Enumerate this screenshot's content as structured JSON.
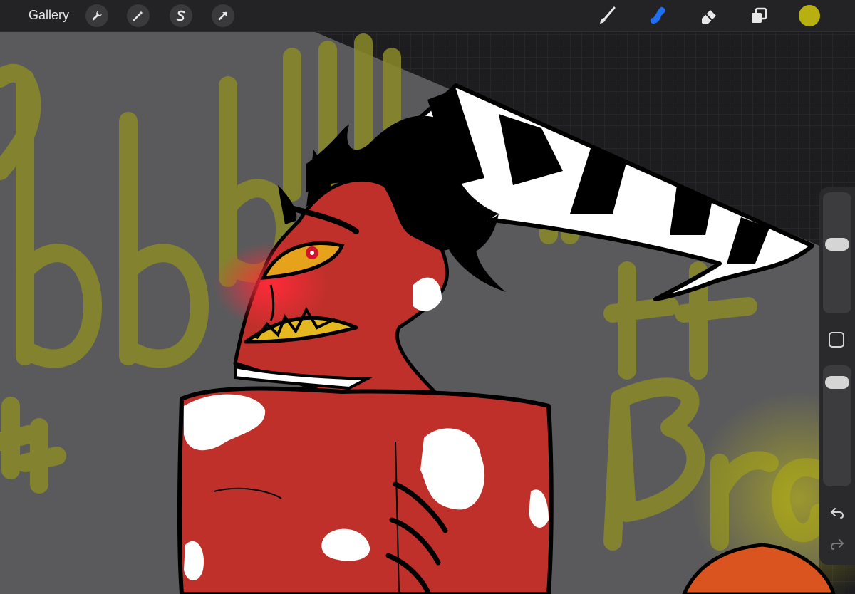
{
  "topbar": {
    "gallery_label": "Gallery",
    "left_tools": [
      "wrench-icon",
      "magic-wand-icon",
      "selection-s-icon",
      "transform-arrow-icon"
    ],
    "right_tools": [
      "brush-icon",
      "smudge-icon",
      "eraser-icon",
      "layers-icon"
    ],
    "active_tool": "smudge-icon",
    "active_color": "#b8b010"
  },
  "canvas": {
    "background_color": "#5a5a5c",
    "sketch_text_color": "#8a8a28",
    "sketch_text": [
      "bb",
      "bbllll",
      "tt",
      "Bra"
    ]
  },
  "sidebar": {
    "brush_size_level": 0.58,
    "opacity_level": 0.08,
    "undo_icon": "undo-icon",
    "redo_icon": "redo-icon"
  }
}
